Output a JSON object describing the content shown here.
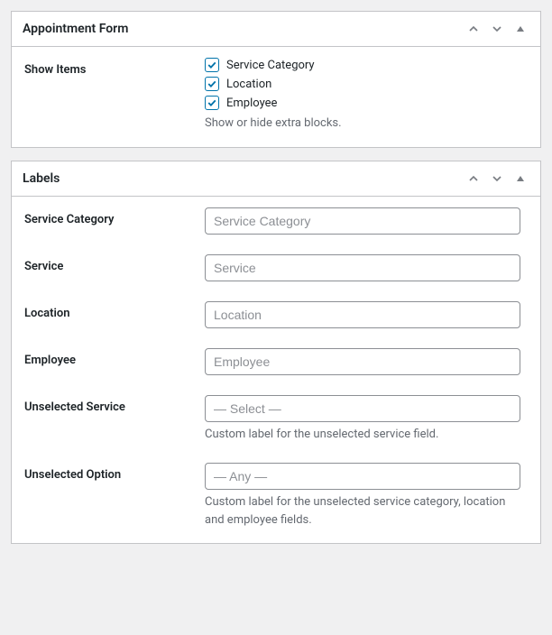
{
  "panels": {
    "appointment": {
      "title": "Appointment Form",
      "show_items": {
        "label": "Show Items",
        "options": [
          {
            "label": "Service Category",
            "checked": true
          },
          {
            "label": "Location",
            "checked": true
          },
          {
            "label": "Employee",
            "checked": true
          }
        ],
        "help": "Show or hide extra blocks."
      }
    },
    "labels": {
      "title": "Labels",
      "fields": {
        "service_category": {
          "label": "Service Category",
          "placeholder": "Service Category",
          "value": ""
        },
        "service": {
          "label": "Service",
          "placeholder": "Service",
          "value": ""
        },
        "location": {
          "label": "Location",
          "placeholder": "Location",
          "value": ""
        },
        "employee": {
          "label": "Employee",
          "placeholder": "Employee",
          "value": ""
        },
        "unselected_service": {
          "label": "Unselected Service",
          "placeholder": "— Select —",
          "value": "",
          "help": "Custom label for the unselected service field."
        },
        "unselected_option": {
          "label": "Unselected Option",
          "placeholder": "— Any —",
          "value": "",
          "help": "Custom label for the unselected service category, location and employee fields."
        }
      }
    }
  }
}
